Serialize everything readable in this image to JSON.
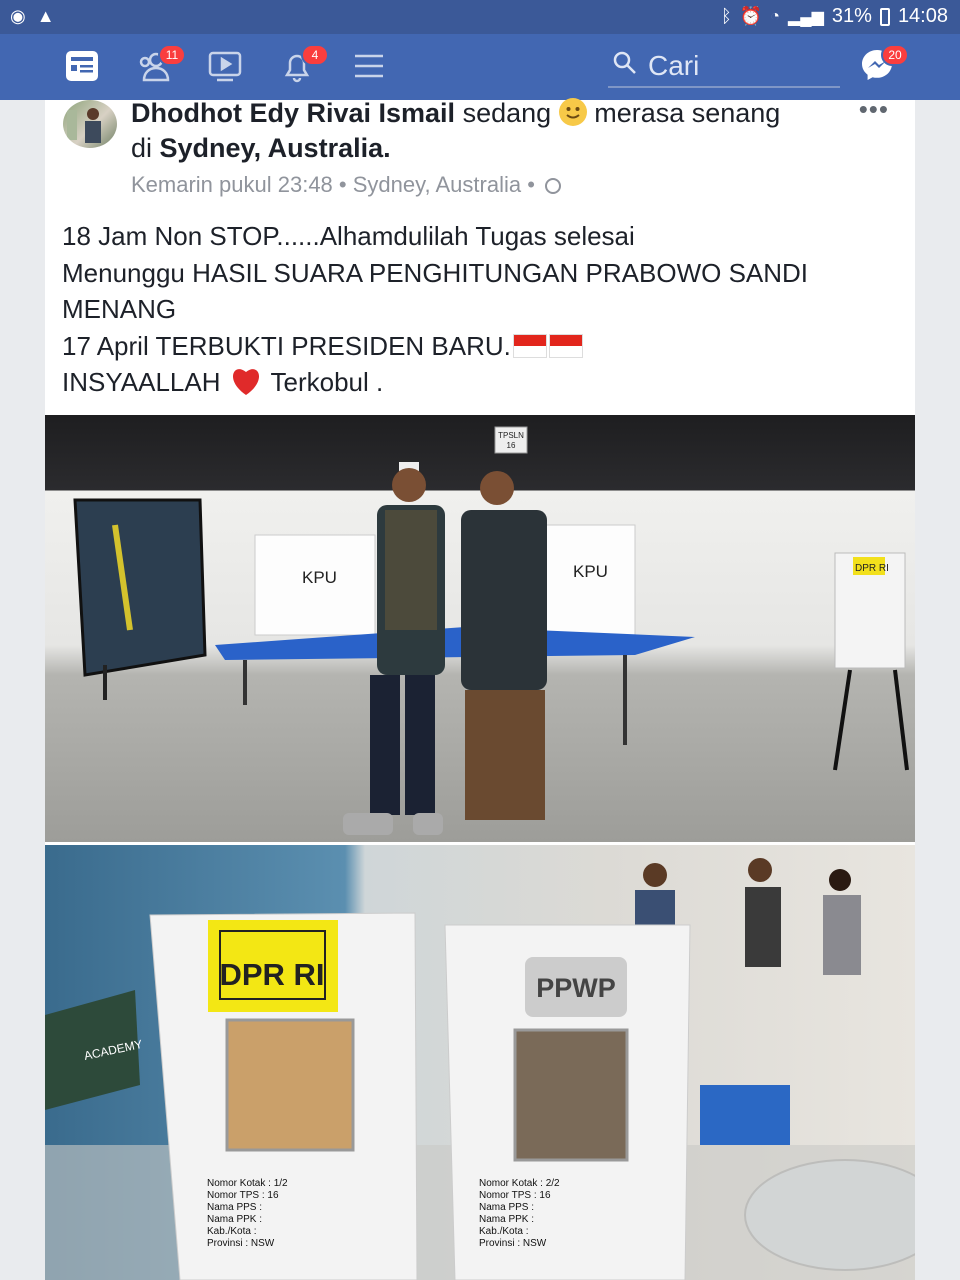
{
  "status_bar": {
    "left_icons": [
      "circle-icon",
      "warning-icon"
    ],
    "battery": "31%",
    "time": "14:08"
  },
  "navbar": {
    "friends_badge": "11",
    "notifications_badge": "4",
    "search_placeholder": "Cari",
    "messenger_badge": "20"
  },
  "post": {
    "author": "Dhodhot Edy Rivai Ismail",
    "activity_prefix": "sedang",
    "activity_suffix": "merasa senang",
    "location_prefix": "di",
    "location": "Sydney, Australia.",
    "timestamp": "Kemarin pukul 23:48",
    "place": "Sydney, Australia",
    "text_line1": "18 Jam Non STOP......Alhamdulilah Tugas selesai",
    "text_line2": "Menunggu HASIL SUARA PENGHITUNGAN  PRABOWO SANDI MENANG",
    "text_line3": "17 April TERBUKTI PRESIDEN BARU.",
    "text_line4a": "INSYAALLAH",
    "text_line4b": "Terkobul ."
  },
  "photo1": {
    "sign": "TPSLN 16",
    "booth_left": "KPU",
    "booth_right": "KPU",
    "box_label": "DPR RI"
  },
  "photo2": {
    "box1_label": "DPR RI",
    "box2_label": "PPWP",
    "box1_form": [
      "Nomor Kotak : 1/2",
      "Nomor TPS   : 16",
      "Nama PPS    :",
      "Nama PPK    :",
      "Kab./Kota   :",
      "Provinsi    : NSW"
    ],
    "box2_form": [
      "Nomor Kotak : 2/2",
      "Nomor TPS   : 16",
      "Nama PPS    :",
      "Nama PPK    :",
      "Kab./Kota   :",
      "Provinsi    : NSW"
    ],
    "banner": "ACADEMY"
  }
}
